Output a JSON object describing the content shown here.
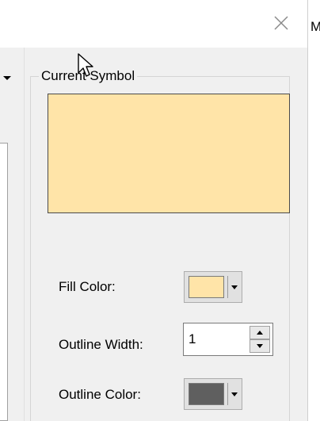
{
  "window": {
    "close_icon": "close-icon",
    "edge_text": "ME"
  },
  "symbol_group": {
    "title": "Current Symbol",
    "preview_fill": "#ffe4a8",
    "preview_outline": "#4a4a4a"
  },
  "fill_color": {
    "label": "Fill Color:",
    "value": "#ffe4a8"
  },
  "outline_width": {
    "label": "Outline Width:",
    "value": "1"
  },
  "outline_color": {
    "label": "Outline Color:",
    "value": "#5f5f5f"
  }
}
